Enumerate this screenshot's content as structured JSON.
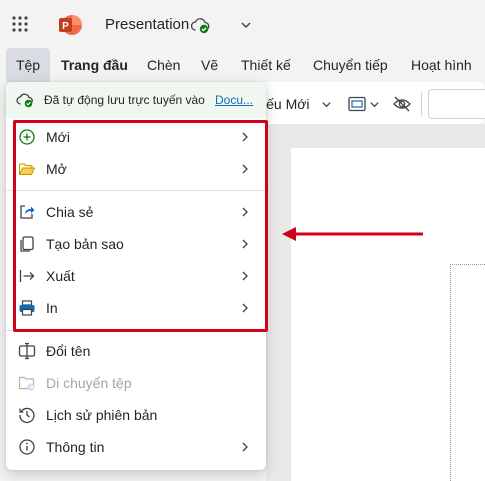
{
  "app": {
    "document_title": "Presentation",
    "icon_names": [
      "waffle-icon",
      "powerpoint-logo-icon",
      "cloud-saved-icon",
      "chevron-down-icon"
    ],
    "brand_color": "#c43e1c",
    "accent_color": "#0f6cbd",
    "annotation_color": "#d0021b"
  },
  "tabs": [
    {
      "label": "Tệp"
    },
    {
      "label": "Trang đầu"
    },
    {
      "label": "Chèn"
    },
    {
      "label": "Vẽ"
    },
    {
      "label": "Thiết kế"
    },
    {
      "label": "Chuyển tiếp"
    },
    {
      "label": "Hoạt hình"
    }
  ],
  "ribbon": {
    "new_slide_label": "iếu Mới"
  },
  "file_menu": {
    "autosave_text": "Đã tự động lưu trực tuyến vào",
    "autosave_link": "Docu...",
    "items": [
      {
        "label": "Mới",
        "icon": "plus-circle-icon",
        "submenu": true
      },
      {
        "label": "Mở",
        "icon": "folder-open-icon",
        "submenu": true
      },
      {
        "label": "Chia sẻ",
        "icon": "share-icon",
        "submenu": true
      },
      {
        "label": "Tạo bản sao",
        "icon": "copy-icon",
        "submenu": true
      },
      {
        "label": "Xuất",
        "icon": "export-arrow-icon",
        "submenu": true
      },
      {
        "label": "In",
        "icon": "printer-icon",
        "submenu": true
      },
      {
        "label": "Đổi tên",
        "icon": "rename-icon",
        "submenu": false
      },
      {
        "label": "Di chuyển tệp",
        "icon": "move-file-icon",
        "submenu": false,
        "disabled": true
      },
      {
        "label": "Lịch sử phiên bản",
        "icon": "history-icon",
        "submenu": false
      },
      {
        "label": "Thông tin",
        "icon": "info-icon",
        "submenu": true
      }
    ]
  }
}
